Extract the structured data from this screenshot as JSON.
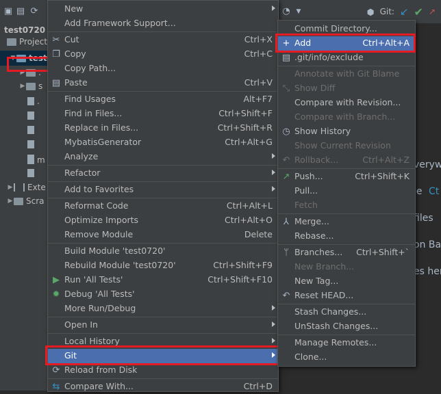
{
  "project": {
    "name": "test0720"
  },
  "toolbar": {
    "git_label": "Git:"
  },
  "tree": [
    {
      "label": "Project",
      "type": "header"
    },
    {
      "label": "test",
      "type": "folder",
      "selected": true
    },
    {
      "label": ".",
      "type": "folder"
    },
    {
      "label": "s",
      "type": "folder"
    },
    {
      "label": ".",
      "type": "file"
    },
    {
      "label": "",
      "type": "file"
    },
    {
      "label": "",
      "type": "file"
    },
    {
      "label": "",
      "type": "file"
    },
    {
      "label": "",
      "type": "file"
    },
    {
      "label": "m",
      "type": "file"
    },
    {
      "label": "",
      "type": "file"
    },
    {
      "label": "Exte",
      "type": "lib"
    },
    {
      "label": "Scra",
      "type": "folder"
    }
  ],
  "editor_text": [
    "verywh",
    "le",
    "Ct",
    "files",
    "on Ba",
    "es her"
  ],
  "context_menu": [
    {
      "label": "New",
      "shortcut": "",
      "submenu": true
    },
    {
      "label": "Add Framework Support...",
      "shortcut": ""
    },
    {
      "sep": true
    },
    {
      "label": "Cut",
      "shortcut": "Ctrl+X",
      "icon": "scissors-icon"
    },
    {
      "label": "Copy",
      "shortcut": "Ctrl+C",
      "icon": "copy-icon"
    },
    {
      "label": "Copy Path...",
      "shortcut": ""
    },
    {
      "label": "Paste",
      "shortcut": "Ctrl+V",
      "icon": "paste-icon"
    },
    {
      "sep": true
    },
    {
      "label": "Find Usages",
      "shortcut": "Alt+F7"
    },
    {
      "label": "Find in Files...",
      "shortcut": "Ctrl+Shift+F"
    },
    {
      "label": "Replace in Files...",
      "shortcut": "Ctrl+Shift+R"
    },
    {
      "label": "MybatisGenerator",
      "shortcut": "Ctrl+Alt+G"
    },
    {
      "label": "Analyze",
      "shortcut": "",
      "submenu": true
    },
    {
      "sep": true
    },
    {
      "label": "Refactor",
      "shortcut": "",
      "submenu": true
    },
    {
      "sep": true
    },
    {
      "label": "Add to Favorites",
      "shortcut": "",
      "submenu": true
    },
    {
      "sep": true
    },
    {
      "label": "Reformat Code",
      "shortcut": "Ctrl+Alt+L"
    },
    {
      "label": "Optimize Imports",
      "shortcut": "Ctrl+Alt+O"
    },
    {
      "label": "Remove Module",
      "shortcut": "Delete"
    },
    {
      "sep": true
    },
    {
      "label": "Build Module 'test0720'",
      "shortcut": ""
    },
    {
      "label": "Rebuild Module 'test0720'",
      "shortcut": "Ctrl+Shift+F9"
    },
    {
      "label": "Run 'All Tests'",
      "shortcut": "Ctrl+Shift+F10",
      "icon": "run-icon"
    },
    {
      "label": "Debug 'All Tests'",
      "shortcut": "",
      "icon": "debug-icon"
    },
    {
      "label": "More Run/Debug",
      "shortcut": "",
      "submenu": true
    },
    {
      "sep": true
    },
    {
      "label": "Open In",
      "shortcut": "",
      "submenu": true
    },
    {
      "sep": true
    },
    {
      "label": "Local History",
      "shortcut": "",
      "submenu": true
    },
    {
      "label": "Git",
      "shortcut": "",
      "submenu": true,
      "selected": true
    },
    {
      "label": "Reload from Disk",
      "shortcut": "",
      "icon": "reload-icon"
    },
    {
      "sep": true
    },
    {
      "label": "Compare With...",
      "shortcut": "Ctrl+D",
      "icon": "compare-icon"
    }
  ],
  "git_menu": [
    {
      "label": "Commit Directory...",
      "shortcut": ""
    },
    {
      "label": "Add",
      "shortcut": "Ctrl+Alt+A",
      "icon": "plus-icon",
      "selected": true
    },
    {
      "label": ".git/info/exclude",
      "shortcut": "",
      "icon": "git-file-icon"
    },
    {
      "sep": true
    },
    {
      "label": "Annotate with Git Blame",
      "shortcut": "",
      "disabled": true
    },
    {
      "label": "Show Diff",
      "shortcut": "",
      "disabled": true,
      "icon": "diff-icon"
    },
    {
      "label": "Compare with Revision...",
      "shortcut": ""
    },
    {
      "label": "Compare with Branch...",
      "shortcut": "",
      "disabled": true
    },
    {
      "label": "Show History",
      "shortcut": "",
      "icon": "clock-icon"
    },
    {
      "label": "Show Current Revision",
      "shortcut": "",
      "disabled": true
    },
    {
      "label": "Rollback...",
      "shortcut": "Ctrl+Alt+Z",
      "disabled": true,
      "icon": "rollback-icon"
    },
    {
      "sep": true
    },
    {
      "label": "Push...",
      "shortcut": "Ctrl+Shift+K",
      "icon": "push-icon"
    },
    {
      "label": "Pull...",
      "shortcut": ""
    },
    {
      "label": "Fetch",
      "shortcut": "",
      "disabled": true
    },
    {
      "sep": true
    },
    {
      "label": "Merge...",
      "shortcut": "",
      "icon": "merge-icon"
    },
    {
      "label": "Rebase...",
      "shortcut": ""
    },
    {
      "sep": true
    },
    {
      "label": "Branches...",
      "shortcut": "Ctrl+Shift+`",
      "icon": "branch-icon"
    },
    {
      "label": "New Branch...",
      "shortcut": "",
      "disabled": true
    },
    {
      "label": "New Tag...",
      "shortcut": ""
    },
    {
      "label": "Reset HEAD...",
      "shortcut": "",
      "icon": "reset-icon"
    },
    {
      "sep": true
    },
    {
      "label": "Stash Changes...",
      "shortcut": ""
    },
    {
      "label": "UnStash Changes...",
      "shortcut": ""
    },
    {
      "sep": true
    },
    {
      "label": "Manage Remotes...",
      "shortcut": ""
    },
    {
      "label": "Clone...",
      "shortcut": ""
    }
  ]
}
